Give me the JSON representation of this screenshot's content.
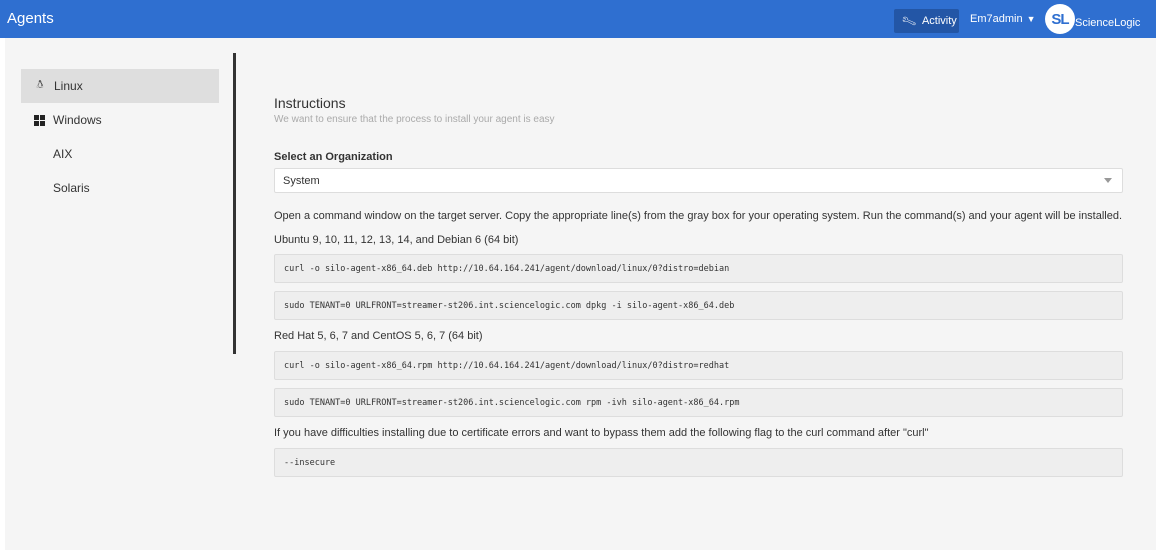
{
  "header": {
    "title": "Agents",
    "activity_label": "Activity",
    "user_label": "Em7admin",
    "logo_mark": "SL",
    "logo_text": "ScienceLogic",
    "accent": "#2f6fd0"
  },
  "sidebar": {
    "items": [
      {
        "label": "Linux",
        "icon": "linux-icon",
        "active": true
      },
      {
        "label": "Windows",
        "icon": "windows-icon",
        "active": false
      },
      {
        "label": "AIX",
        "icon": "",
        "active": false
      },
      {
        "label": "Solaris",
        "icon": "",
        "active": false
      }
    ]
  },
  "main": {
    "heading": "Instructions",
    "subheading": "We want to ensure that the process to install your agent is easy",
    "org_label": "Select an Organization",
    "org_value": "System",
    "intro": "Open a command window on the target server. Copy the appropriate line(s) from the gray box for your operating system. Run the command(s) and your agent will be installed.",
    "debian_label": "Ubuntu 9, 10, 11, 12, 13, 14, and Debian 6 (64 bit)",
    "debian_cmd_1": "curl -o silo-agent-x86_64.deb http://10.64.164.241/agent/download/linux/0?distro=debian",
    "debian_cmd_2": "sudo TENANT=0 URLFRONT=streamer-st206.int.sciencelogic.com dpkg -i silo-agent-x86_64.deb",
    "redhat_label": "Red Hat 5, 6, 7 and CentOS 5, 6, 7 (64 bit)",
    "redhat_cmd_1": "curl -o silo-agent-x86_64.rpm http://10.64.164.241/agent/download/linux/0?distro=redhat",
    "redhat_cmd_2": "sudo TENANT=0 URLFRONT=streamer-st206.int.sciencelogic.com rpm -ivh silo-agent-x86_64.rpm",
    "cert_note": "If you have difficulties installing due to certificate errors and want to bypass them add the following flag to the curl command after \"curl\"",
    "insecure_flag": "--insecure"
  }
}
